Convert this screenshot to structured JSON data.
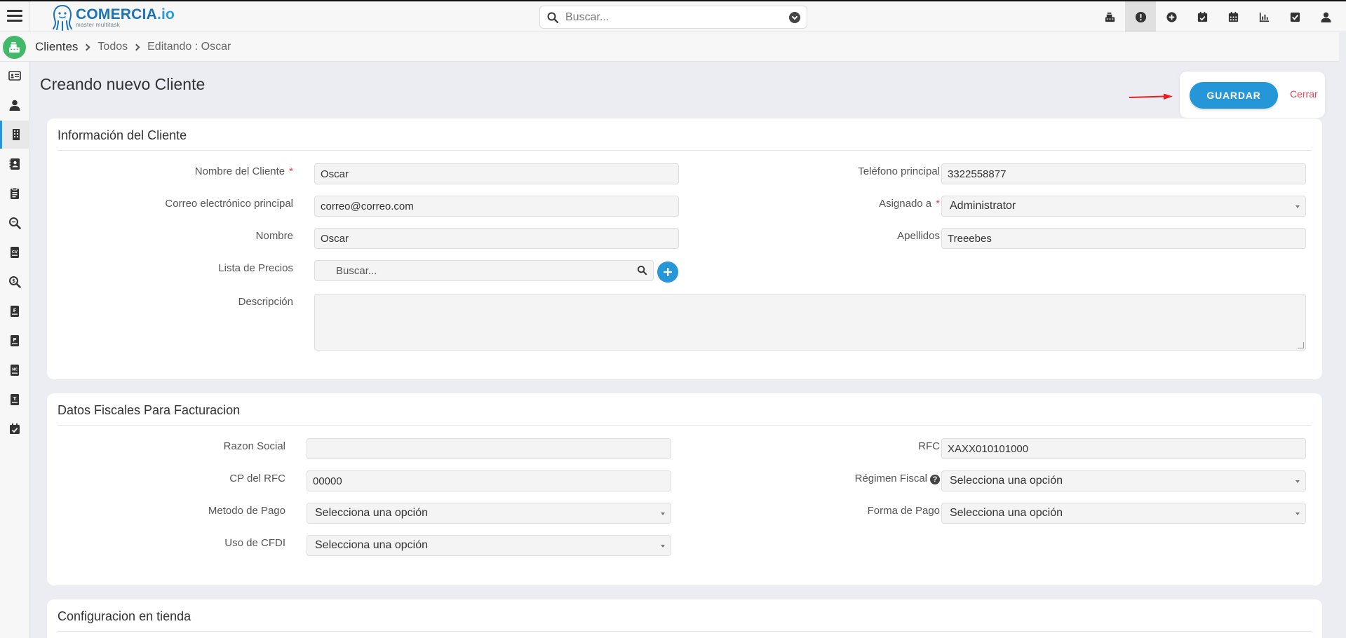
{
  "app": {
    "logo_name": "COMERCIA",
    "logo_suffix": ".io",
    "logo_tagline": "master multitask"
  },
  "search": {
    "placeholder": "Buscar..."
  },
  "top_icons": [
    {
      "icon": "cash-register-icon",
      "active": false
    },
    {
      "icon": "alert-icon",
      "active": true
    },
    {
      "icon": "add-circle-icon",
      "active": false
    },
    {
      "icon": "calendar-check-icon",
      "active": false
    },
    {
      "icon": "calendar-icon",
      "active": false
    },
    {
      "icon": "chart-icon",
      "active": false
    },
    {
      "icon": "checkbox-icon",
      "active": false
    },
    {
      "icon": "user-icon",
      "active": false
    }
  ],
  "breadcrumb": {
    "module": "Clientes",
    "list": "Todos",
    "current": "Editando : Oscar"
  },
  "sidebar": [
    {
      "icon": "id-card-icon"
    },
    {
      "icon": "user-icon"
    },
    {
      "icon": "building-icon",
      "active": true
    },
    {
      "icon": "contact-book-icon"
    },
    {
      "icon": "clipboard-icon"
    },
    {
      "icon": "search-document-icon"
    },
    {
      "icon": "quote-icon"
    },
    {
      "icon": "search-dollar-icon"
    },
    {
      "icon": "invoice-icon"
    },
    {
      "icon": "payment-icon"
    },
    {
      "icon": "credit-note-icon"
    },
    {
      "icon": "ticket-icon"
    },
    {
      "icon": "calendar-check-icon"
    }
  ],
  "page": {
    "title": "Creando nuevo Cliente"
  },
  "actions": {
    "save_label": "GUARDAR",
    "close_label": "Cerrar"
  },
  "client_info": {
    "title": "Información del Cliente",
    "nombre_cliente": {
      "label": "Nombre del Cliente",
      "value": "Oscar"
    },
    "telefono": {
      "label": "Teléfono principal",
      "value": "3322558877"
    },
    "correo": {
      "label": "Correo electrónico principal",
      "value": "correo@correo.com"
    },
    "asignado": {
      "label": "Asignado a",
      "value": "Administrator"
    },
    "nombre": {
      "label": "Nombre",
      "value": "Oscar"
    },
    "apellidos": {
      "label": "Apellidos",
      "value": "Treeebes"
    },
    "lista_precios": {
      "label": "Lista de Precios",
      "placeholder": "Buscar..."
    },
    "descripcion": {
      "label": "Descripción",
      "value": ""
    }
  },
  "fiscal": {
    "title": "Datos Fiscales Para Facturacion",
    "razon_social": {
      "label": "Razon Social",
      "value": ""
    },
    "rfc": {
      "label": "RFC",
      "value": "XAXX010101000"
    },
    "cp_rfc": {
      "label": "CP del RFC",
      "value": "00000"
    },
    "regimen": {
      "label": "Régimen Fiscal",
      "help": "?",
      "value": "Selecciona una opción"
    },
    "metodo_pago": {
      "label": "Metodo de Pago",
      "value": "Selecciona una opción"
    },
    "forma_pago": {
      "label": "Forma de Pago",
      "value": "Selecciona una opción"
    },
    "uso_cfdi": {
      "label": "Uso de CFDI",
      "value": "Selecciona una opción"
    }
  },
  "store": {
    "title": "Configuracion en tienda"
  },
  "colors": {
    "accent": "#2596d8",
    "danger": "#e0445b",
    "success": "#44b86a"
  }
}
